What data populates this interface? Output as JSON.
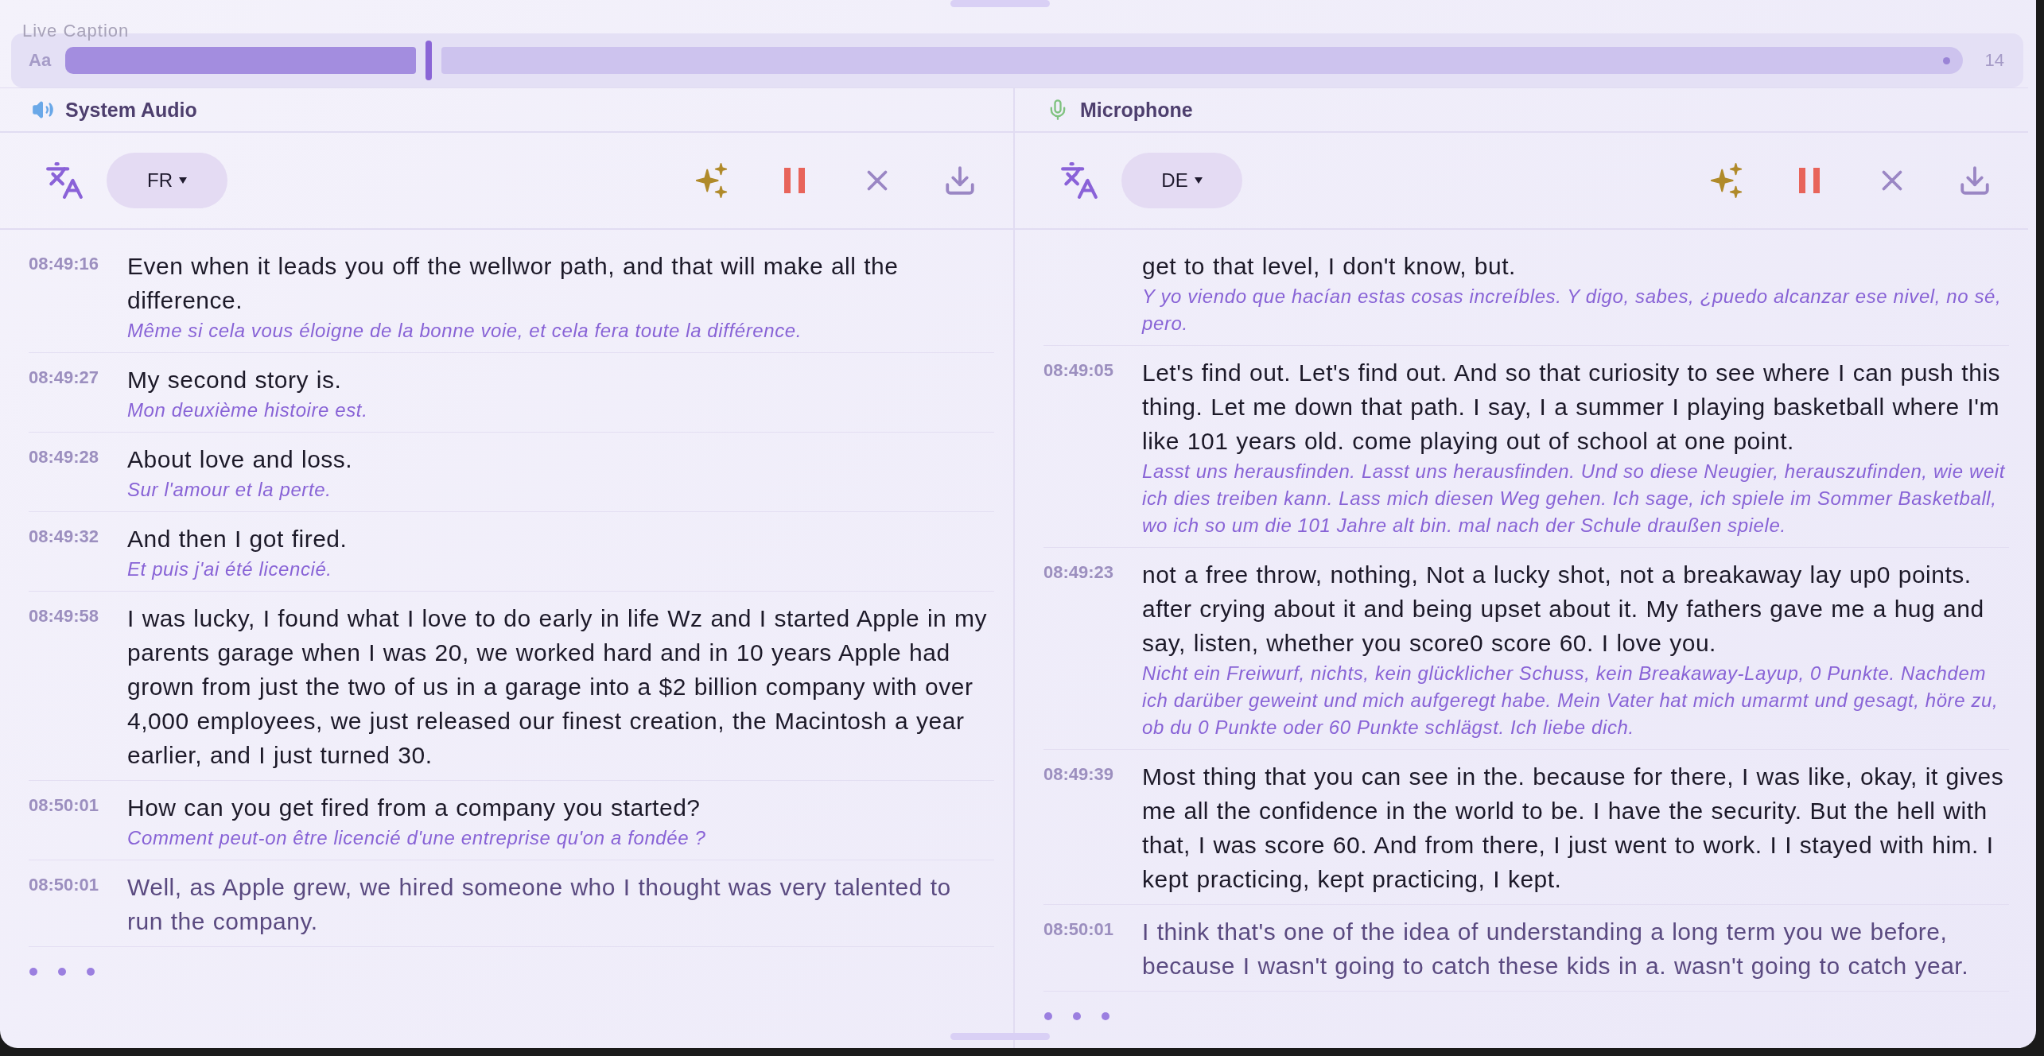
{
  "caption_bar": {
    "title": "Live Caption",
    "font_label": "Aa",
    "size": {
      "level": 0.185,
      "reading": "14"
    }
  },
  "panels": [
    {
      "source": "System Audio",
      "kind": "speaker",
      "language": "FR",
      "entries": [
        {
          "time": "08:49:16",
          "text": "Even when it leads you off the wellwor path, and that will make all the difference.",
          "translation": "Même si cela vous éloigne de la bonne voie, et cela fera toute la différence.",
          "live": false
        },
        {
          "time": "08:49:27",
          "text": "My second story is.",
          "translation": "Mon deuxième histoire est.",
          "live": false
        },
        {
          "time": "08:49:28",
          "text": "About love and loss.",
          "translation": "Sur l'amour et la perte.",
          "live": false
        },
        {
          "time": "08:49:32",
          "text": "And then I got fired.",
          "translation": "Et puis j'ai été licencié.",
          "live": false
        },
        {
          "time": "08:49:58",
          "text": "I was lucky, I found what I love to do early in life Wz and I started Apple in my parents garage when I was 20, we worked hard and in 10 years Apple had grown from just the two of us in a garage into a $2 billion company with over 4,000 employees, we just released our finest creation, the Macintosh a year earlier, and I just turned 30.",
          "live": false
        },
        {
          "time": "08:50:01",
          "text": "How can you get fired from a company you started?",
          "translation": "Comment peut-on être licencié d'une entreprise qu'on a fondée ?",
          "live": false
        },
        {
          "time": "08:50:01",
          "text": "Well, as Apple grew, we hired someone who I thought was very talented to run the company.",
          "live": true
        }
      ]
    },
    {
      "source": "Microphone",
      "kind": "mic",
      "language": "DE",
      "entries": [
        {
          "text": "get to that level, I don't know, but.",
          "translation": "Y yo viendo que hacían estas cosas increíbles. Y digo, sabes, ¿puedo alcanzar ese nivel, no sé, pero.",
          "live": false
        },
        {
          "time": "08:49:05",
          "text": "Let's find out. Let's find out. And so that curiosity to see where I can push this thing. Let me down that path. I say, I a summer I playing basketball where I'm like 101 years old. come playing out of school at one point.",
          "translation": "Lasst uns herausfinden. Lasst uns herausfinden. Und so diese Neugier, herauszufinden, wie weit ich dies treiben kann. Lass mich diesen Weg gehen. Ich sage, ich spiele im Sommer Basketball, wo ich so um die 101 Jahre alt bin. mal nach der Schule draußen spiele.",
          "live": false
        },
        {
          "time": "08:49:23",
          "text": "not a free throw, nothing, Not a lucky shot, not a breakaway lay up0 points. after crying about it and being upset about it. My fathers gave me a hug and say, listen, whether you score0 score 60. I love you.",
          "translation": "Nicht ein Freiwurf, nichts, kein glücklicher Schuss, kein Breakaway-Layup, 0 Punkte. Nachdem ich darüber geweint und mich aufgeregt habe. Mein Vater hat mich umarmt und gesagt, höre zu, ob du 0 Punkte oder 60 Punkte schlägst. Ich liebe dich.",
          "live": false
        },
        {
          "time": "08:49:39",
          "text": "Most thing that you can see in the. because for there, I was like, okay, it gives me all the confidence in the world to be. I have the security. But the hell with that, I was score 60. And from there, I just went to work. I I stayed with him. I kept practicing, kept practicing, I kept.",
          "live": false
        },
        {
          "time": "08:50:01",
          "text": "I think that's one of the idea of understanding a long term you we before, because I wasn't going to catch these kids in a. wasn't going to catch year.",
          "live": true
        }
      ]
    }
  ]
}
